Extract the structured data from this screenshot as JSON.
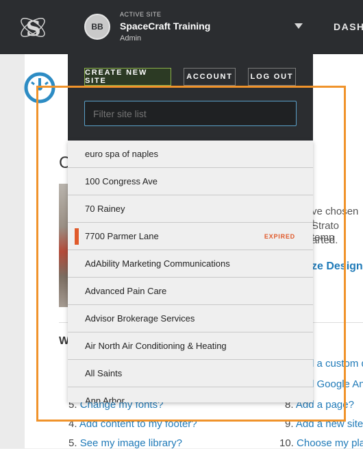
{
  "topbar": {
    "dashboard_fragment": "DASH"
  },
  "switcher": {
    "avatar_initials": "BB",
    "active_label": "ACTIVE SITE",
    "site_name": "SpaceCraft Training",
    "role": "Admin",
    "buttons": {
      "create": "CREATE NEW SITE",
      "account": "ACCOUNT",
      "logout": "LOG OUT"
    },
    "filter_placeholder": "Filter site list",
    "sites": [
      {
        "name": "euro spa of naples",
        "expired": false
      },
      {
        "name": "100 Congress Ave",
        "expired": false
      },
      {
        "name": "70 Rainey",
        "expired": false
      },
      {
        "name": "7700 Parmer Lane",
        "expired": true
      },
      {
        "name": "AdAbility Marketing Communications",
        "expired": false
      },
      {
        "name": "Advanced Pain Care",
        "expired": false
      },
      {
        "name": "Advisor Brokerage Services",
        "expired": false
      },
      {
        "name": "Air North Air Conditioning & Heating",
        "expired": false
      },
      {
        "name": "All Saints",
        "expired": false
      },
      {
        "name": "Ann Arbor",
        "expired": false
      }
    ],
    "expired_label": "EXPIRED"
  },
  "background": {
    "title_fragment": "C",
    "right_lines": [
      "ve chosen t",
      "Strato temp",
      "arted."
    ],
    "customize_link": "ze Design",
    "w_fragment": "W",
    "faq_left": [
      {
        "num": "5.",
        "text": "Change my fonts?"
      },
      {
        "num": "4.",
        "text": "Add content to my footer?"
      },
      {
        "num": "5.",
        "text": "See my image library?"
      }
    ],
    "faq_right": [
      {
        "num": "",
        "text": "l a custom d"
      },
      {
        "num": "",
        "text": "l Google An"
      },
      {
        "num": "8.",
        "text": "Add a page?"
      },
      {
        "num": "9.",
        "text": "Add a new site"
      },
      {
        "num": "10.",
        "text": "Choose my pla"
      }
    ]
  },
  "colors": {
    "accent_orange": "#f0932b",
    "expired_red": "#e05a2b",
    "link_blue": "#1f7ab8"
  }
}
